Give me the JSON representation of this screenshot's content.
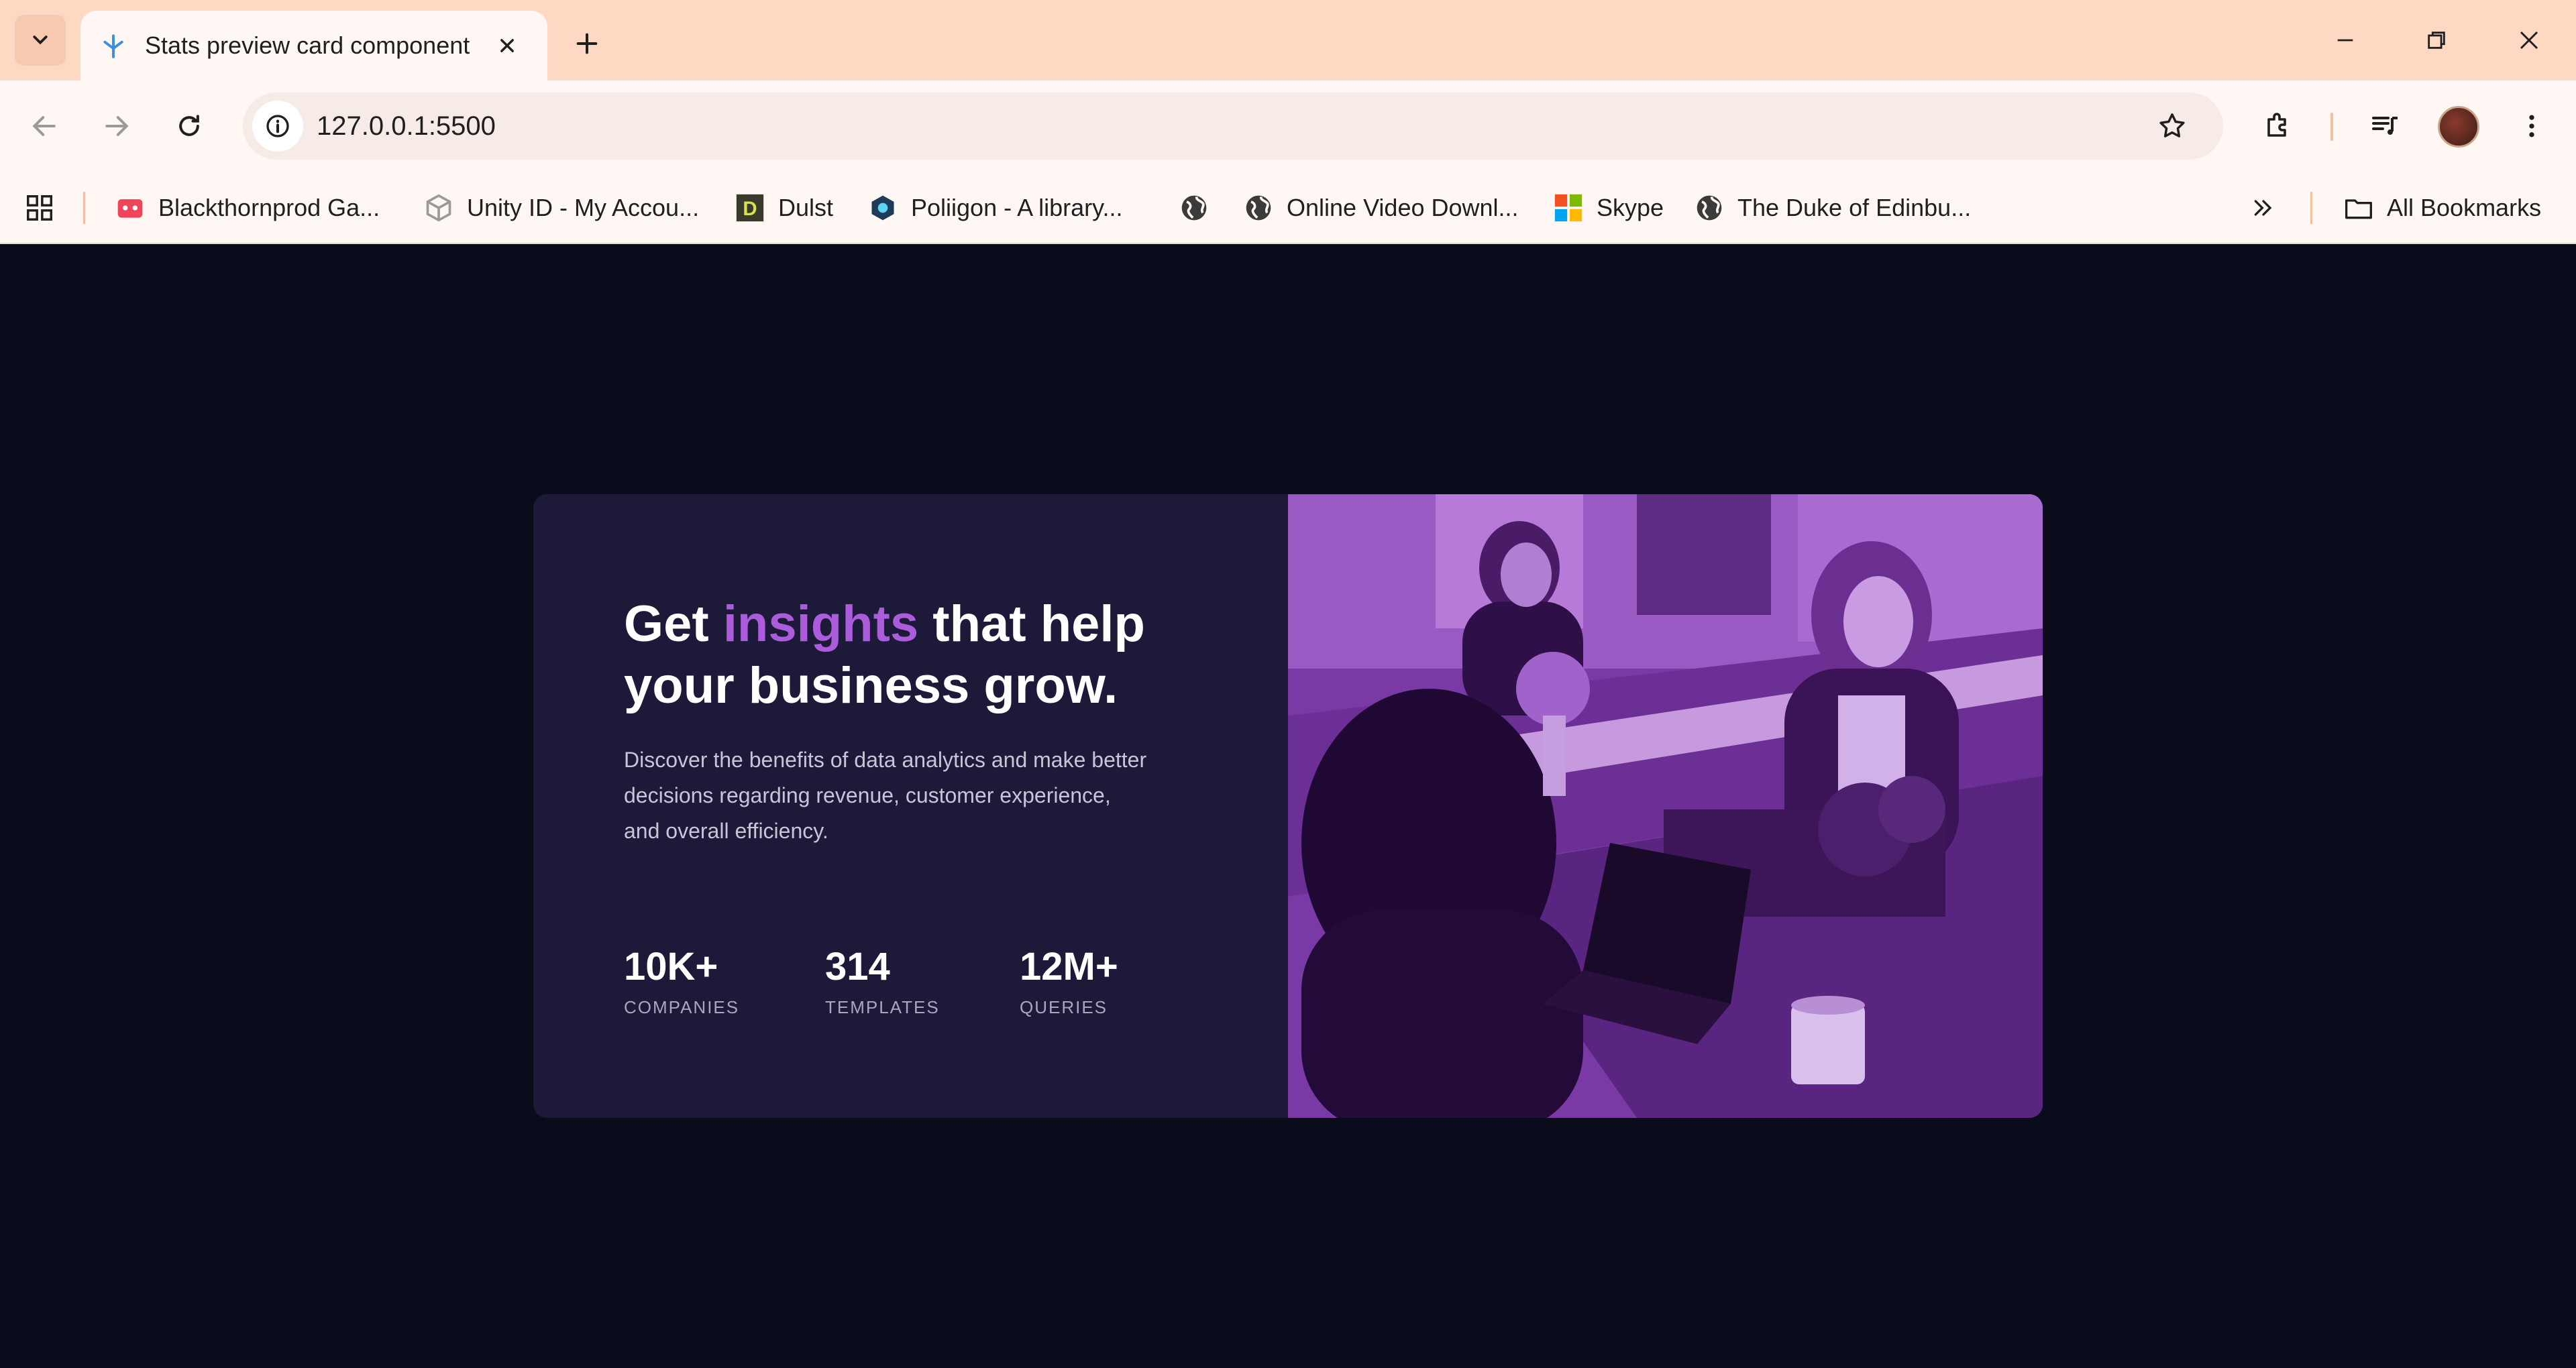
{
  "browser": {
    "tab_title": "Stats preview card component",
    "url": "127.0.0.1:5500",
    "bookmarks": [
      {
        "label": "Blackthornprod Ga...",
        "icon": "gamepad-icon"
      },
      {
        "label": "Unity ID - My Accou...",
        "icon": "unity-icon"
      },
      {
        "label": "Dulst",
        "icon": "dulst-icon"
      },
      {
        "label": "Poliigon - A library...",
        "icon": "poliigon-icon"
      },
      {
        "label": "",
        "icon": "globe-icon"
      },
      {
        "label": "Online Video Downl...",
        "icon": "globe-icon"
      },
      {
        "label": "Skype",
        "icon": "microsoft-icon"
      },
      {
        "label": "The Duke of Edinbu...",
        "icon": "globe-icon"
      }
    ],
    "all_bookmarks": "All Bookmarks"
  },
  "card": {
    "title_start": "Get ",
    "title_accent": "insights",
    "title_end": " that help your business grow.",
    "description": "Discover the benefits of data analytics and make better decisions regarding revenue, customer experience, and overall efficiency.",
    "stats": [
      {
        "value": "10K+",
        "label": "COMPANIES"
      },
      {
        "value": "314",
        "label": "TEMPLATES"
      },
      {
        "value": "12M+",
        "label": "QUERIES"
      }
    ],
    "image_tint": "#7b3aa6",
    "accent_color": "#aa5cdb"
  }
}
